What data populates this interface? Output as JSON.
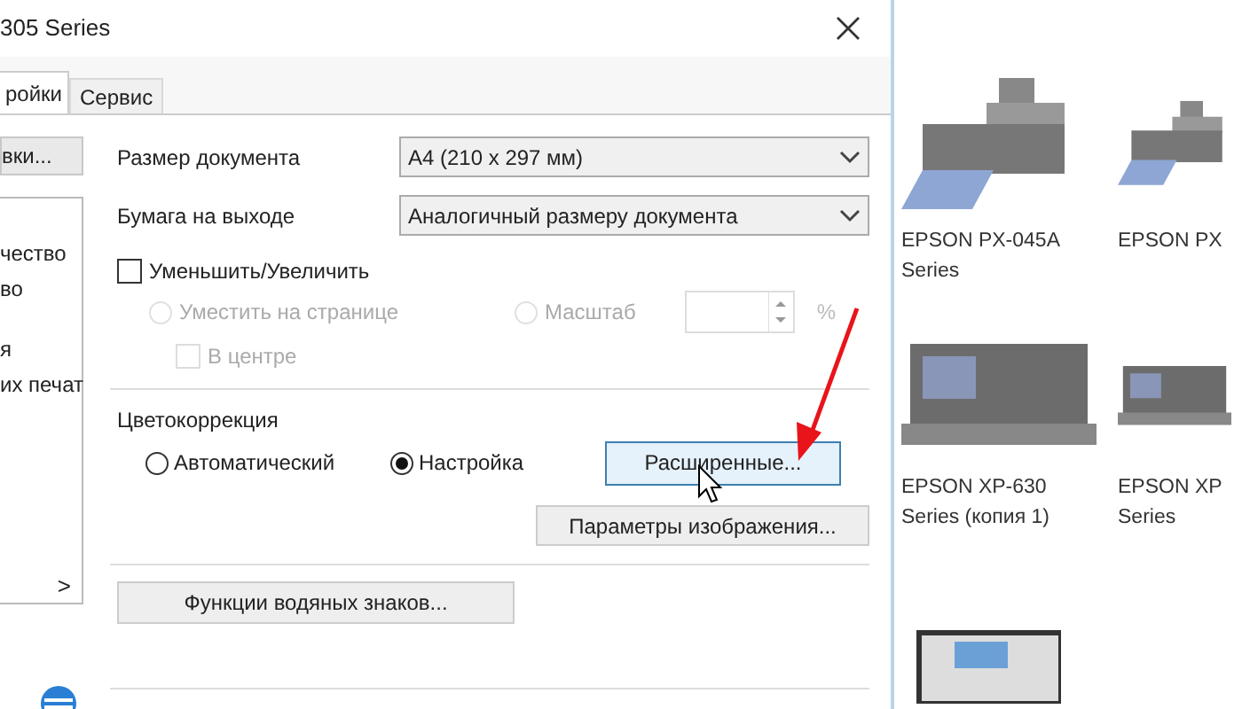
{
  "window": {
    "title": "305 Series"
  },
  "tabs": [
    {
      "label": "ройки",
      "selected": true
    },
    {
      "label": "Сервис",
      "selected": false
    }
  ],
  "left_pane": {
    "button": "вки...",
    "items": [
      "чество",
      "во",
      "я",
      "их печат"
    ],
    "scroll_arrow": ">"
  },
  "document_size": {
    "label": "Размер документа",
    "value": "A4 (210 x 297 мм)"
  },
  "output_paper": {
    "label": "Бумага на выходе",
    "value": "Аналогичный размеру документа"
  },
  "reduce_enlarge": {
    "label": "Уменьшить/Увеличить",
    "checked": false,
    "disabled": false
  },
  "fit_options": [
    {
      "label": "Уместить на странице",
      "selected": false,
      "disabled": true
    },
    {
      "label": "Масштаб",
      "selected": false,
      "disabled": true
    }
  ],
  "scale_unit": "%",
  "center": {
    "label": "В центре",
    "checked": false,
    "disabled": true
  },
  "color_correction": {
    "label": "Цветокоррекция",
    "options": [
      {
        "label": "Автоматический",
        "selected": false
      },
      {
        "label": "Настройка",
        "selected": true
      }
    ]
  },
  "buttons": [
    {
      "label": "Расширенные...",
      "focused": true
    },
    {
      "label": "Параметры изображения...",
      "focused": false
    }
  ],
  "watermark_button": "Функции водяных знаков...",
  "printers": [
    {
      "name": "EPSON PX-045A Series",
      "kind": "inkjet"
    },
    {
      "name": "EPSON PX",
      "kind": "inkjet"
    },
    {
      "name": "EPSON XP-630 Series (копия 1)",
      "kind": "multifunction"
    },
    {
      "name": "EPSON XP Series",
      "kind": "multifunction"
    },
    {
      "kind": "photo"
    }
  ]
}
